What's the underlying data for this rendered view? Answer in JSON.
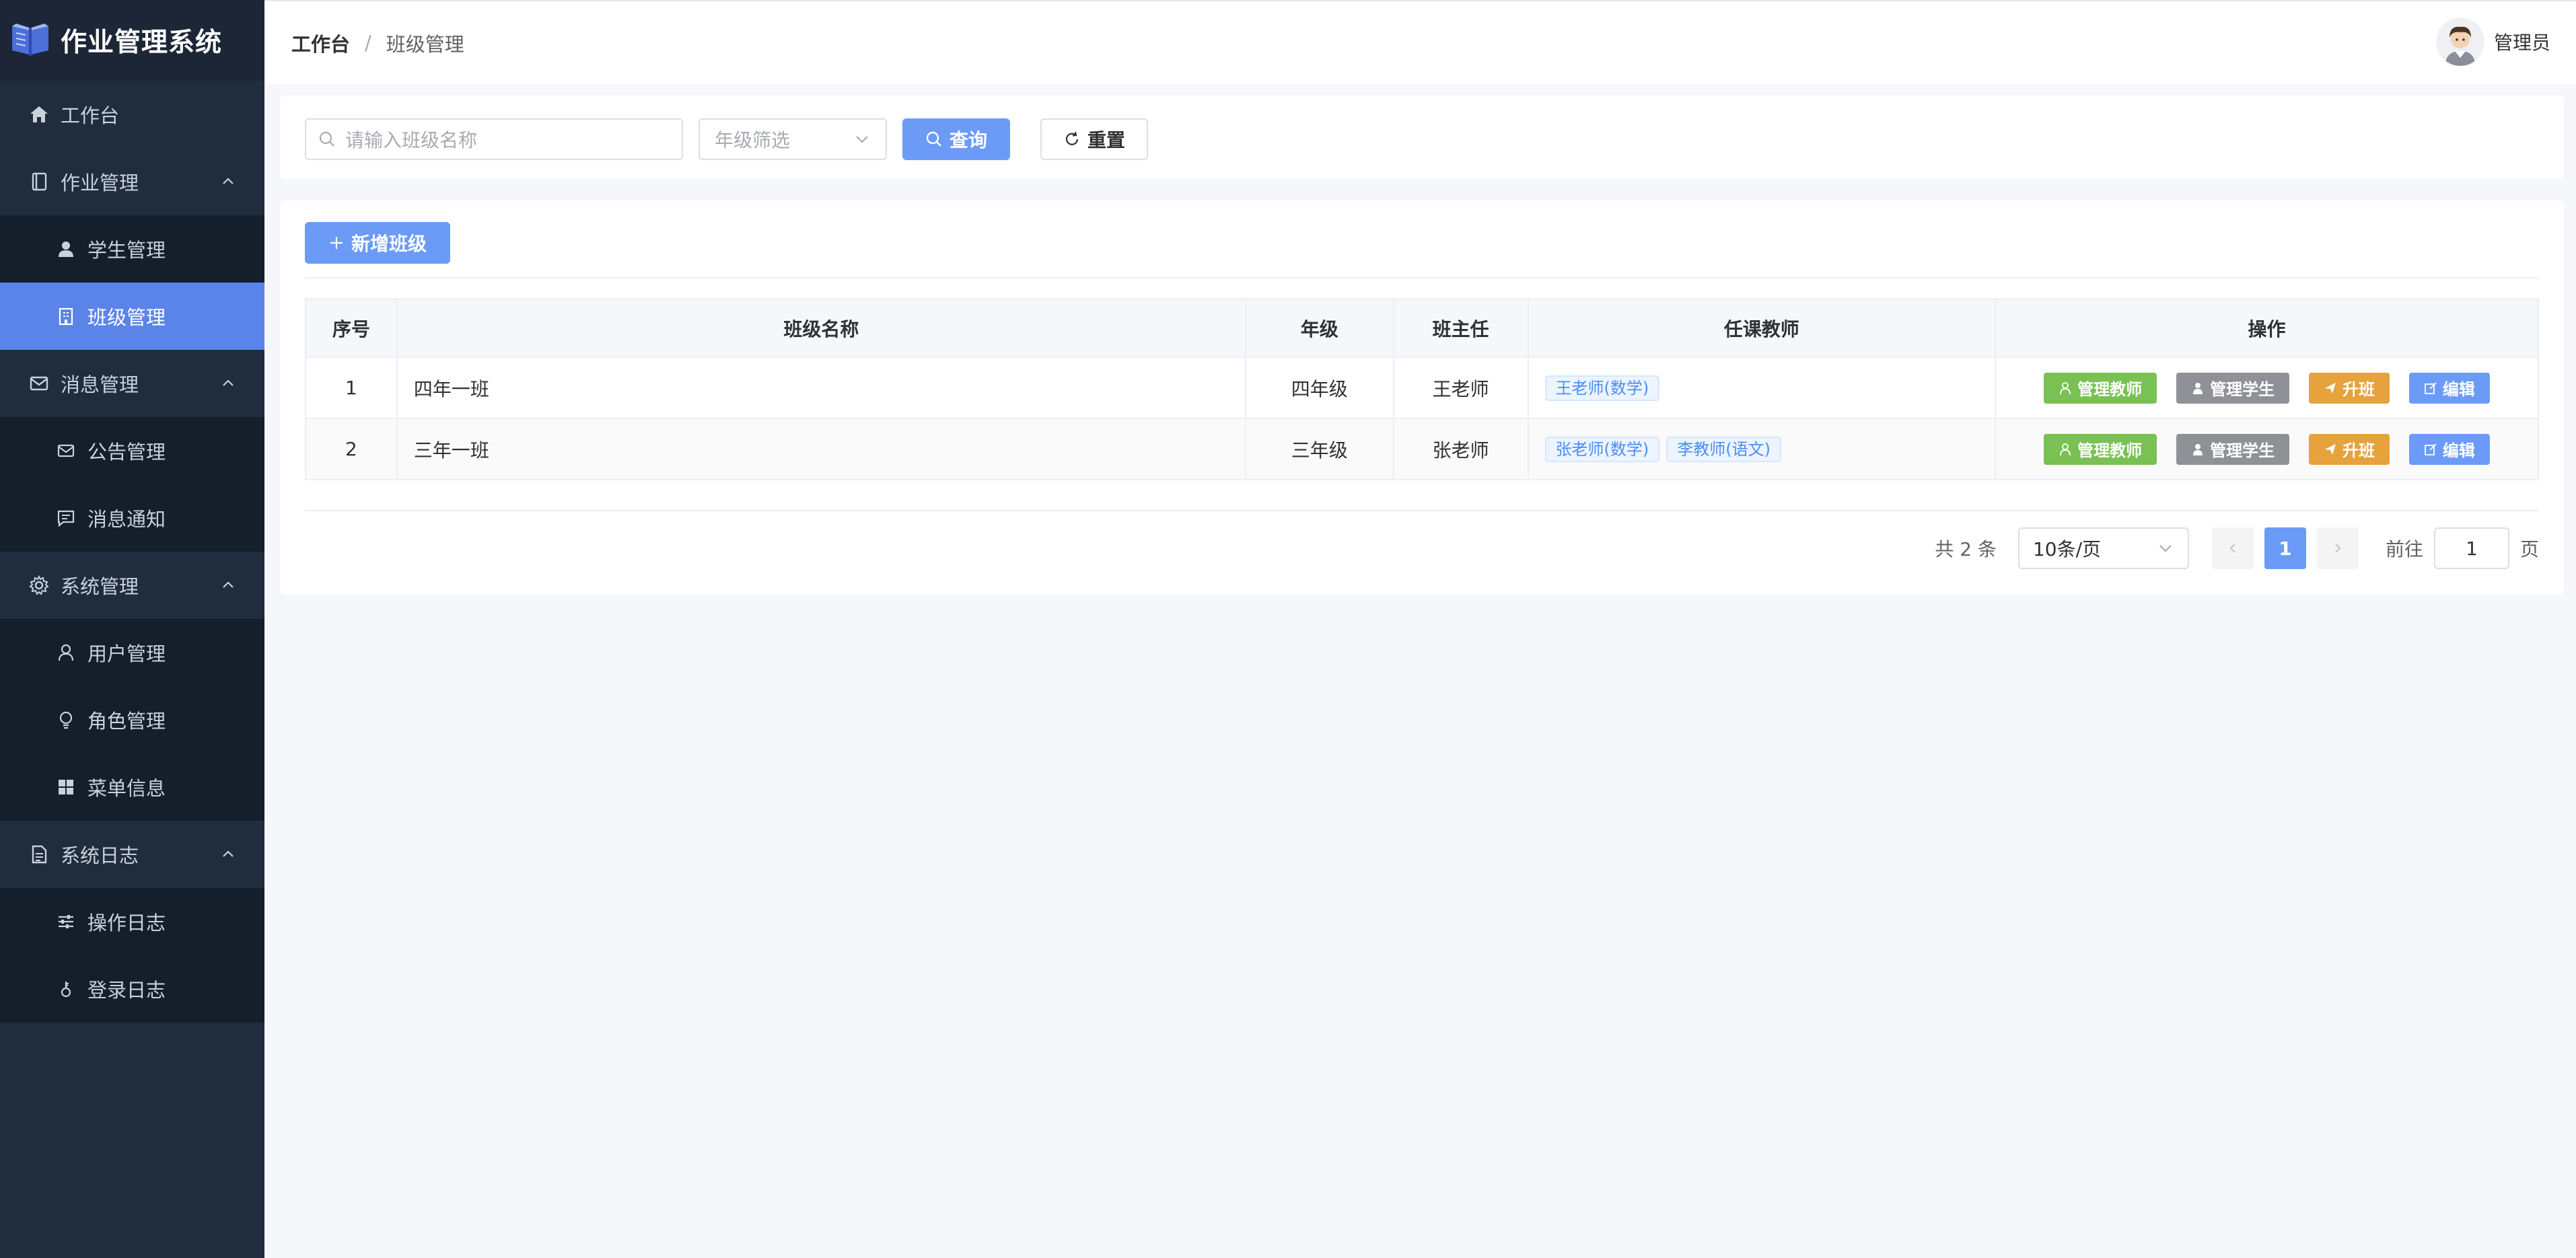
{
  "app": {
    "title": "作业管理系统"
  },
  "sidebar": {
    "items": [
      {
        "label": "工作台",
        "icon": "home-icon",
        "type": "item"
      },
      {
        "label": "作业管理",
        "icon": "notebook-icon",
        "type": "group",
        "expanded": true
      },
      {
        "label": "学生管理",
        "icon": "user-filled-icon",
        "type": "sub"
      },
      {
        "label": "班级管理",
        "icon": "building-icon",
        "type": "sub",
        "active": true
      },
      {
        "label": "消息管理",
        "icon": "mail-icon",
        "type": "group",
        "expanded": true
      },
      {
        "label": "公告管理",
        "icon": "mail-icon",
        "type": "sub"
      },
      {
        "label": "消息通知",
        "icon": "chat-icon",
        "type": "sub"
      },
      {
        "label": "系统管理",
        "icon": "gear-icon",
        "type": "group",
        "expanded": true
      },
      {
        "label": "用户管理",
        "icon": "user-icon",
        "type": "sub"
      },
      {
        "label": "角色管理",
        "icon": "bulb-icon",
        "type": "sub"
      },
      {
        "label": "菜单信息",
        "icon": "grid-icon",
        "type": "sub"
      },
      {
        "label": "系统日志",
        "icon": "document-icon",
        "type": "group",
        "expanded": true
      },
      {
        "label": "操作日志",
        "icon": "sliders-icon",
        "type": "sub"
      },
      {
        "label": "登录日志",
        "icon": "key-icon",
        "type": "sub"
      }
    ]
  },
  "header": {
    "breadcrumb": {
      "home": "工作台",
      "separator": "/",
      "current": "班级管理"
    },
    "user": {
      "name": "管理员"
    }
  },
  "search": {
    "name_placeholder": "请输入班级名称",
    "grade_placeholder": "年级筛选",
    "query_label": "查询",
    "reset_label": "重置"
  },
  "toolbar": {
    "add_label": "新增班级"
  },
  "table": {
    "columns": [
      "序号",
      "班级名称",
      "年级",
      "班主任",
      "任课教师",
      "操作"
    ],
    "rows": [
      {
        "index": "1",
        "name": "四年一班",
        "grade": "四年级",
        "head_teacher": "王老师",
        "teachers": [
          "王老师(数学)"
        ]
      },
      {
        "index": "2",
        "name": "三年一班",
        "grade": "三年级",
        "head_teacher": "张老师",
        "teachers": [
          "张老师(数学)",
          "李教师(语文)"
        ]
      }
    ],
    "actions": {
      "manage_teachers": "管理教师",
      "manage_students": "管理学生",
      "promote": "升班",
      "edit": "编辑"
    }
  },
  "pagination": {
    "total_text": "共 2 条",
    "page_size": "10条/页",
    "current_page": "1",
    "goto_label": "前往",
    "goto_value": "1",
    "page_suffix": "页"
  },
  "colors": {
    "primary": "#6b9bf7",
    "sidebar_bg": "#1f2d3d",
    "active_menu": "#5b84e8",
    "success": "#79c153",
    "info": "#8f9196",
    "warning": "#e6a23c"
  }
}
